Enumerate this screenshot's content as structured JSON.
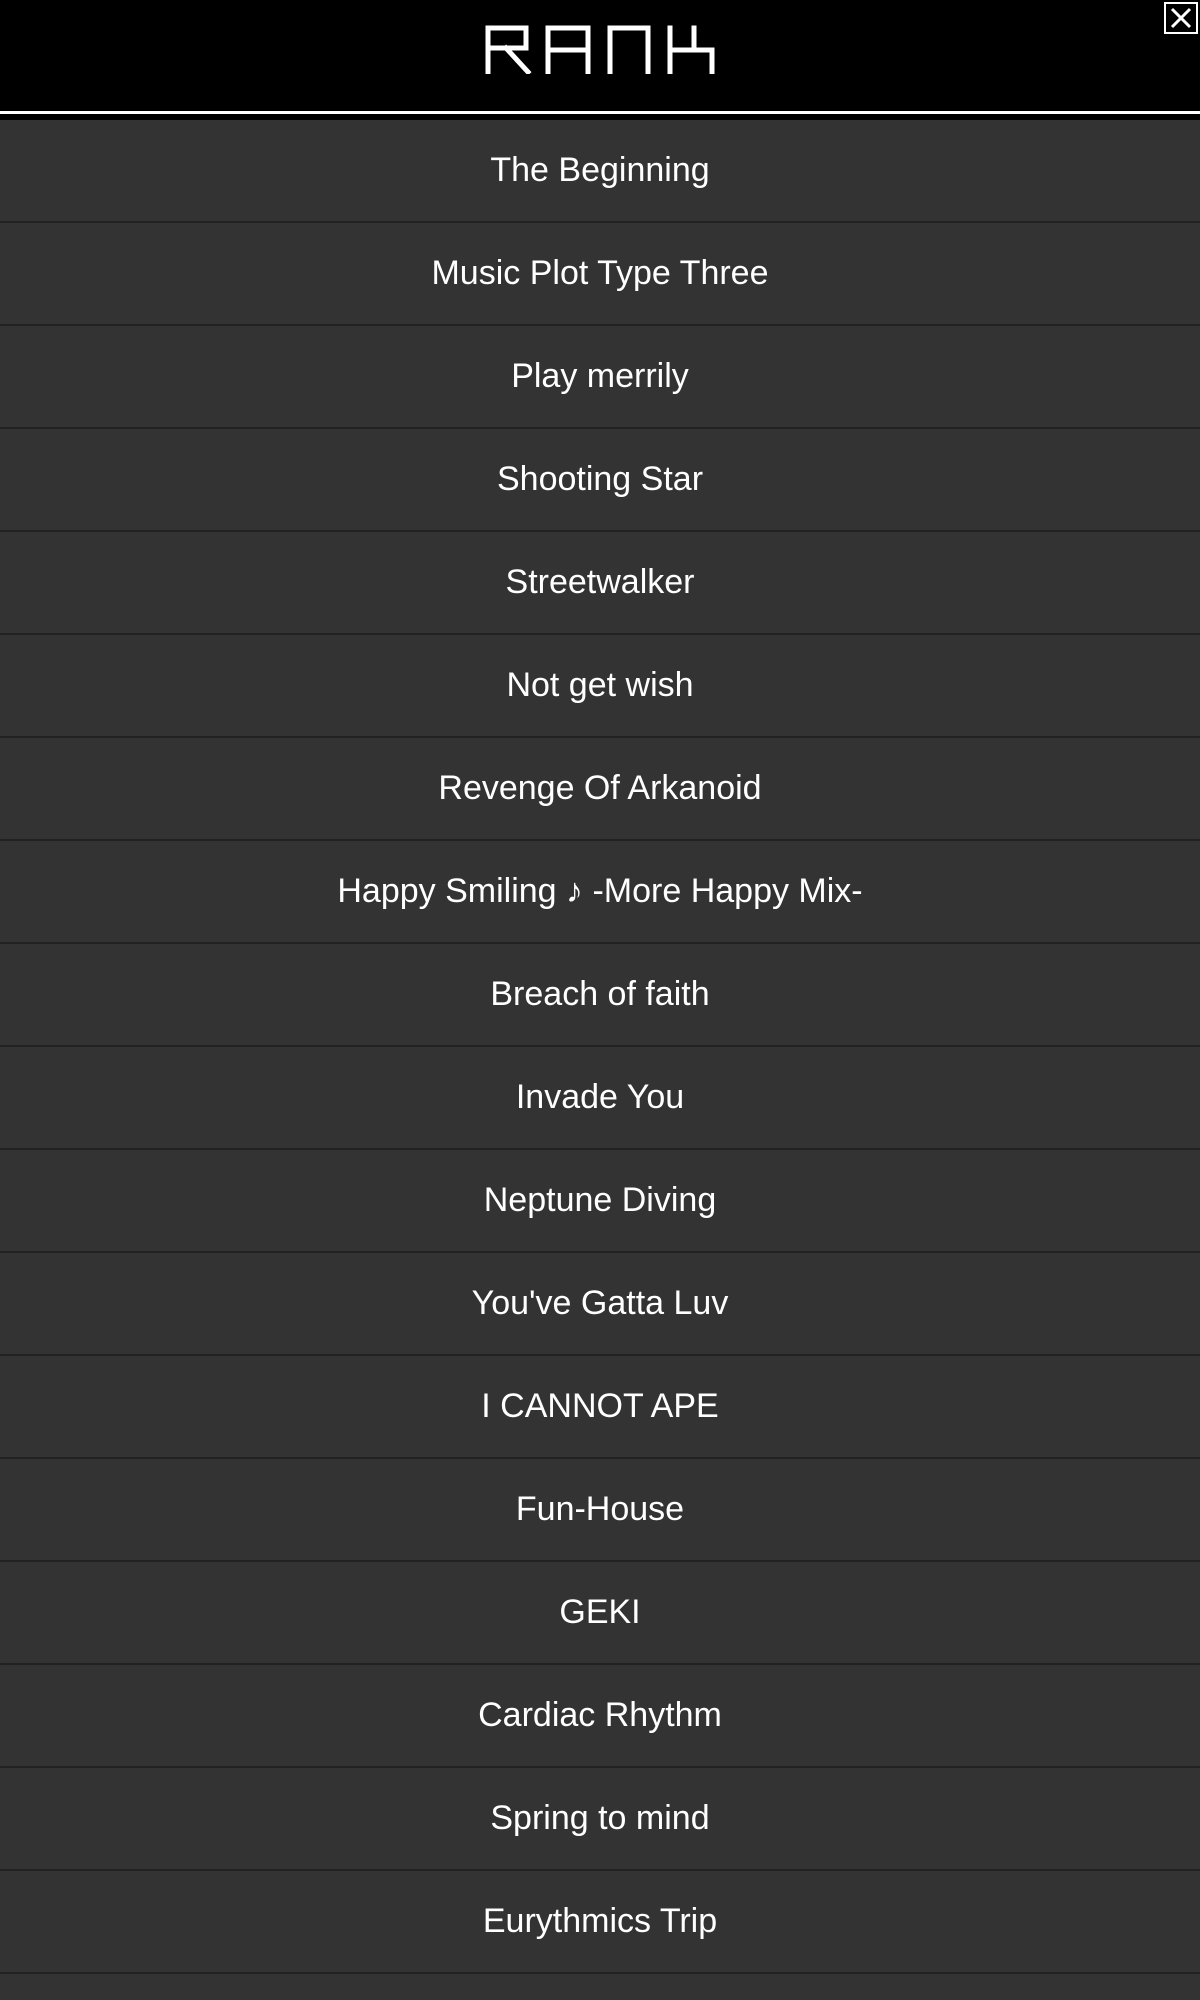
{
  "header": {
    "title": "RANK",
    "close_icon": "close-icon"
  },
  "tracks": [
    {
      "label": "The Beginning"
    },
    {
      "label": "Music Plot Type Three"
    },
    {
      "label": "Play merrily"
    },
    {
      "label": "Shooting Star"
    },
    {
      "label": "Streetwalker"
    },
    {
      "label": "Not get wish"
    },
    {
      "label": "Revenge Of Arkanoid"
    },
    {
      "label": "Happy Smiling ♪ -More Happy Mix-"
    },
    {
      "label": "Breach of faith"
    },
    {
      "label": "Invade You"
    },
    {
      "label": "Neptune Diving"
    },
    {
      "label": "You've Gatta Luv"
    },
    {
      "label": "I CANNOT APE"
    },
    {
      "label": "Fun-House"
    },
    {
      "label": "GEKI"
    },
    {
      "label": "Cardiac Rhythm"
    },
    {
      "label": "Spring to mind"
    },
    {
      "label": "Eurythmics Trip"
    },
    {
      "label": ""
    }
  ],
  "colors": {
    "header_bg": "#000000",
    "row_bg": "#333333",
    "row_divider": "#222222",
    "text": "#ffffff"
  }
}
